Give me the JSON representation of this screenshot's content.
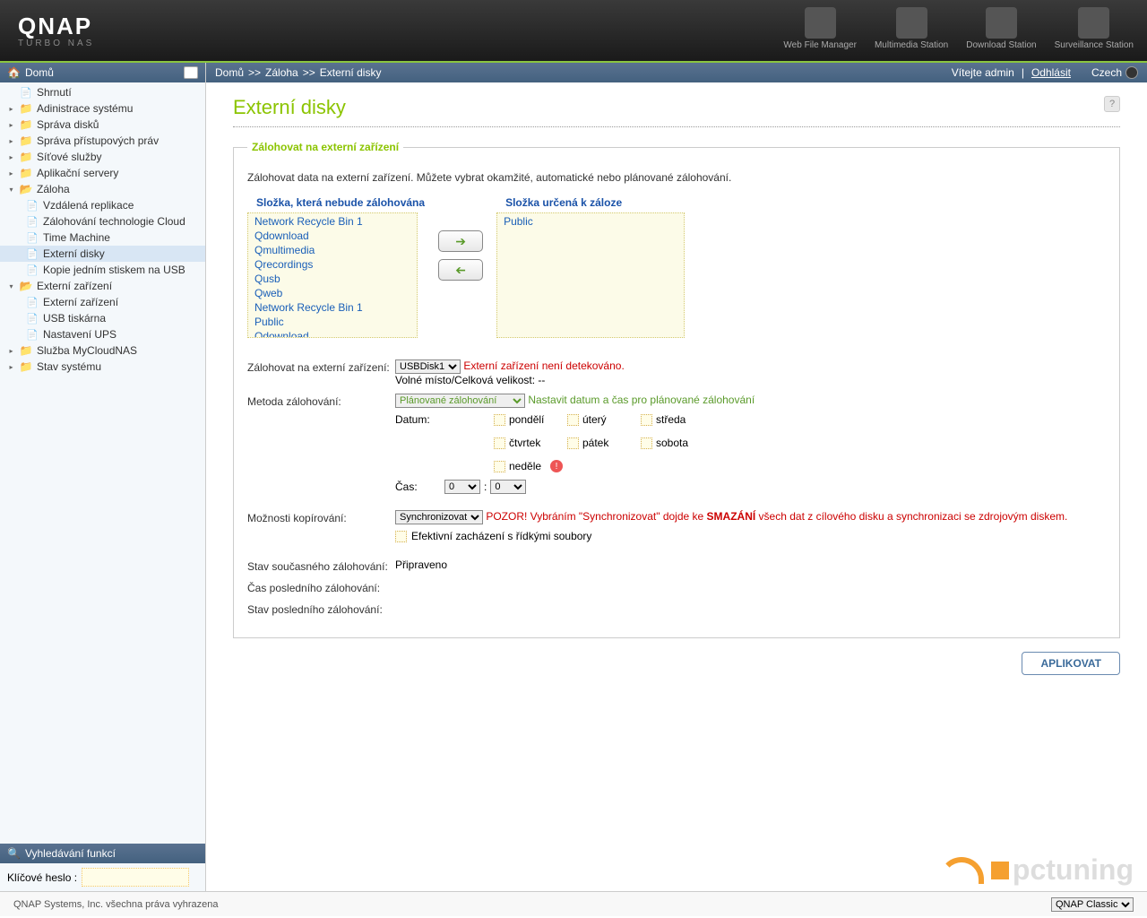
{
  "brand": {
    "name": "QNAP",
    "sub": "TURBO NAS"
  },
  "headerApps": [
    {
      "label": "Web File Manager"
    },
    {
      "label": "Multimedia Station"
    },
    {
      "label": "Download Station"
    },
    {
      "label": "Surveillance Station"
    }
  ],
  "sidebar": {
    "home": "Domů",
    "search": "Vyhledávání funkcí",
    "keyLabel": "Klíčové heslo :",
    "items": [
      {
        "label": "Shrnutí",
        "icon": "page",
        "toggle": ""
      },
      {
        "label": "Adinistrace systému",
        "icon": "folder",
        "toggle": "▸"
      },
      {
        "label": "Správa disků",
        "icon": "folder",
        "toggle": "▸"
      },
      {
        "label": "Správa přístupových práv",
        "icon": "folder",
        "toggle": "▸"
      },
      {
        "label": "Síťové služby",
        "icon": "folder",
        "toggle": "▸"
      },
      {
        "label": "Aplikační servery",
        "icon": "folder",
        "toggle": "▸"
      },
      {
        "label": "Záloha",
        "icon": "folder-open",
        "toggle": "▾",
        "children": [
          {
            "label": "Vzdálená replikace",
            "icon": "page"
          },
          {
            "label": "Zálohování technologie Cloud",
            "icon": "page"
          },
          {
            "label": "Time Machine",
            "icon": "page"
          },
          {
            "label": "Externí disky",
            "icon": "page",
            "selected": true
          },
          {
            "label": "Kopie jedním stiskem na USB",
            "icon": "page"
          }
        ]
      },
      {
        "label": "Externí zařízení",
        "icon": "folder-open",
        "toggle": "▾",
        "children": [
          {
            "label": "Externí zařízení",
            "icon": "page"
          },
          {
            "label": "USB tiskárna",
            "icon": "page"
          },
          {
            "label": "Nastavení UPS",
            "icon": "page"
          }
        ]
      },
      {
        "label": "Služba MyCloudNAS",
        "icon": "folder",
        "toggle": "▸"
      },
      {
        "label": "Stav systému",
        "icon": "folder",
        "toggle": "▸"
      }
    ]
  },
  "breadcrumb": [
    "Domů",
    "Záloha",
    "Externí disky"
  ],
  "welcome": {
    "text": "Vítejte admin",
    "logout": "Odhlásit",
    "lang": "Czech"
  },
  "page": {
    "title": "Externí disky",
    "sectionTitle": "Zálohovat na externí zařízení",
    "desc": "Zálohovat data na externí zařízení. Můžete vybrat okamžité, automatické nebo plánované zálohování.",
    "leftListTitle": "Složka, která nebude zálohována",
    "rightListTitle": "Složka určená k záloze",
    "leftItems": [
      "Network Recycle Bin 1",
      "Qdownload",
      "Qmultimedia",
      "Qrecordings",
      "Qusb",
      "Qweb",
      "Network Recycle Bin 1",
      "Public",
      "Qdownload"
    ],
    "rightItems": [
      "Public"
    ],
    "labels": {
      "backupTo": "Zálohovat na externí zařízení:",
      "disk": "USBDisk1",
      "notDetected": "Externí zařízení není detekováno.",
      "freeSpace": "Volné místo/Celková velikost:  --",
      "method": "Metoda zálohování:",
      "methodValue": "Plánované zálohování",
      "setSchedule": "Nastavit datum a čas pro plánované zálohování",
      "date": "Datum:",
      "days": [
        "pondělí",
        "úterý",
        "středa",
        "čtvrtek",
        "pátek",
        "sobota",
        "neděle"
      ],
      "time": "Čas:",
      "hour": "0",
      "minute": "0",
      "copyOpt": "Možnosti kopírování:",
      "copyValue": "Synchronizovat",
      "warn1": "POZOR! Vybráním \"Synchronizovat\" dojde ke ",
      "warn2": "SMAZÁNÍ",
      "warn3": " všech dat z cílového disku a synchronizaci se zdrojovým diskem.",
      "sparse": "Efektivní zacházení s řídkými soubory",
      "status": "Stav současného zálohování:",
      "statusVal": "Připraveno",
      "lastTime": "Čas posledního zálohování:",
      "lastStatus": "Stav posledního zálohování:"
    },
    "apply": "APLIKOVAT"
  },
  "footer": {
    "copyright": "QNAP Systems, Inc. všechna práva vyhrazena",
    "theme": "QNAP Classic"
  },
  "watermark": "pctuning"
}
